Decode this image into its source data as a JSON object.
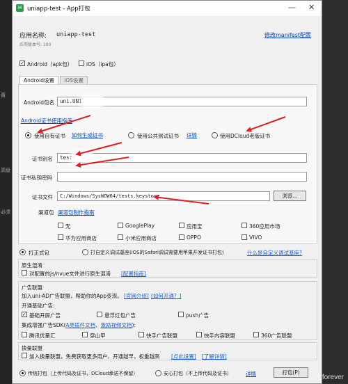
{
  "bg": {
    "left_a": "置",
    "left_b": "高级",
    "left_c": "必须"
  },
  "window": {
    "title": "uniapp-test - App打包",
    "minimize": "—",
    "close": "✕"
  },
  "header": {
    "app_name_label": "应用名称:",
    "app_name": "uniapp-test",
    "version_label": "应用版本号: 100",
    "manifest_link": "修改manifest配置"
  },
  "platforms": [
    {
      "label": "Android（apk包）",
      "checked": "✓"
    },
    {
      "label": "iOS（ipa包）",
      "checked": ""
    }
  ],
  "tabs": [
    "Android设置",
    "iOS设置"
  ],
  "android": {
    "package_label": "Android包名",
    "package_value": "uni.UNI",
    "cert_guide_link": "Android证书使用指南",
    "cert_options": [
      {
        "label": "使用自有证书",
        "link": "如何生成证书"
      },
      {
        "label": "使用公共测试证书",
        "link": "详情"
      },
      {
        "label": "使用DCloud老版证书"
      }
    ],
    "alias_label": "证书别名",
    "alias_value": "tests",
    "password_label": "证书私钥密码",
    "password_value": "",
    "file_label": "证书文件",
    "file_value": "C:/Windows/SysWOW64/tests.keystore",
    "browse": "浏览...",
    "channel_label": "渠道包",
    "channel_link": "渠道包制作指南",
    "channels": [
      "无",
      "GooglePlay",
      "应用宝",
      "360应用市场",
      "华为应用商店",
      "小米应用商店",
      "OPPO",
      "VIVO"
    ]
  },
  "package_type": {
    "formal": "打正式包",
    "custom": "打自定义调试基座(iOS的Safari调试需要用苹果开发证书打包)",
    "custom_link": "什么是自定义调试基座?"
  },
  "native_mix": {
    "title": "原生混淆",
    "option": "对配置的js/nvue文件进行原生混淆",
    "link": "[配置指南]"
  },
  "ad": {
    "title": "广告联盟",
    "desc": "加入uni-AD广告联盟，帮助你的App变现。",
    "link1": "[官网介绍]",
    "link2": "[如何开通？]",
    "basic_label": "开通基础广告:",
    "basic": [
      "基础开屏广告",
      "悬浮红包广告",
      "push广告"
    ],
    "sdk_prefix": "集成增强广告SDK(",
    "sdk_link1": "A类插件文档",
    "sdk_sep": "、",
    "sdk_link2": "激励视频文档",
    "sdk_suffix": "):",
    "sdk": [
      "腾讯优量汇",
      "穿山甲",
      "快手广告联盟",
      "快手内容联盟",
      "360广告联盟"
    ]
  },
  "swap": {
    "title": "换量联盟",
    "desc": "加入换量联盟，免费获取更多用户，开通越早，权重越高",
    "link1": "[点此设置]",
    "link2": "[了解详情]"
  },
  "footer": {
    "traditional": "传统打包（上传代码及证书，DCloud承诺不保留）",
    "safe": "安心打包（不上传代码及证书）",
    "detail": "详情",
    "pack": "打包(P)"
  },
  "watermark": "forever"
}
